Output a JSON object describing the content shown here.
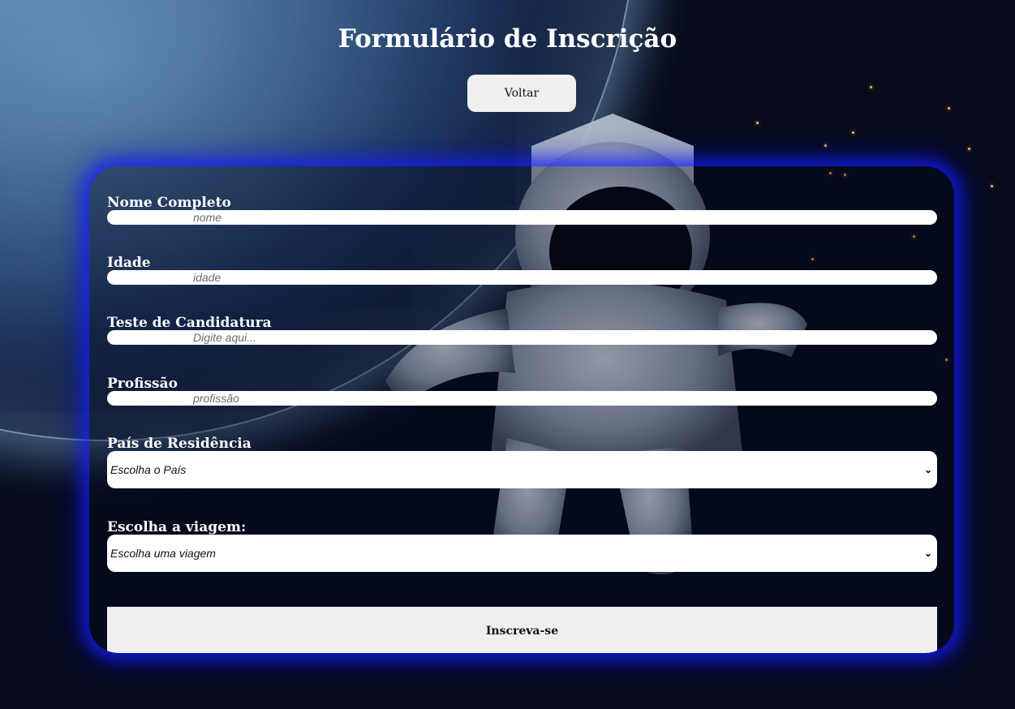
{
  "page": {
    "title": "Formulário de Inscrição",
    "back_label": "Voltar"
  },
  "form": {
    "fields": [
      {
        "label": "Nome Completo",
        "placeholder": "nome",
        "value": ""
      },
      {
        "label": "Idade",
        "placeholder": "idade",
        "value": ""
      },
      {
        "label": "Teste de Candidatura",
        "placeholder": "Digite aqui...",
        "value": ""
      },
      {
        "label": "Profissão",
        "placeholder": "profissão",
        "value": ""
      }
    ],
    "country": {
      "label": "País de Residência",
      "selected": "Escolha o País"
    },
    "trip": {
      "label": "Escolha a viagem:",
      "selected": "Escolha uma viagem"
    },
    "submit_label": "Inscreva-se"
  },
  "icons": {
    "select_arrow": "chevron-down-icon"
  },
  "colors": {
    "panel_glow": "#1420ff",
    "button_bg": "#efefef",
    "label_text": "#ffffff"
  }
}
